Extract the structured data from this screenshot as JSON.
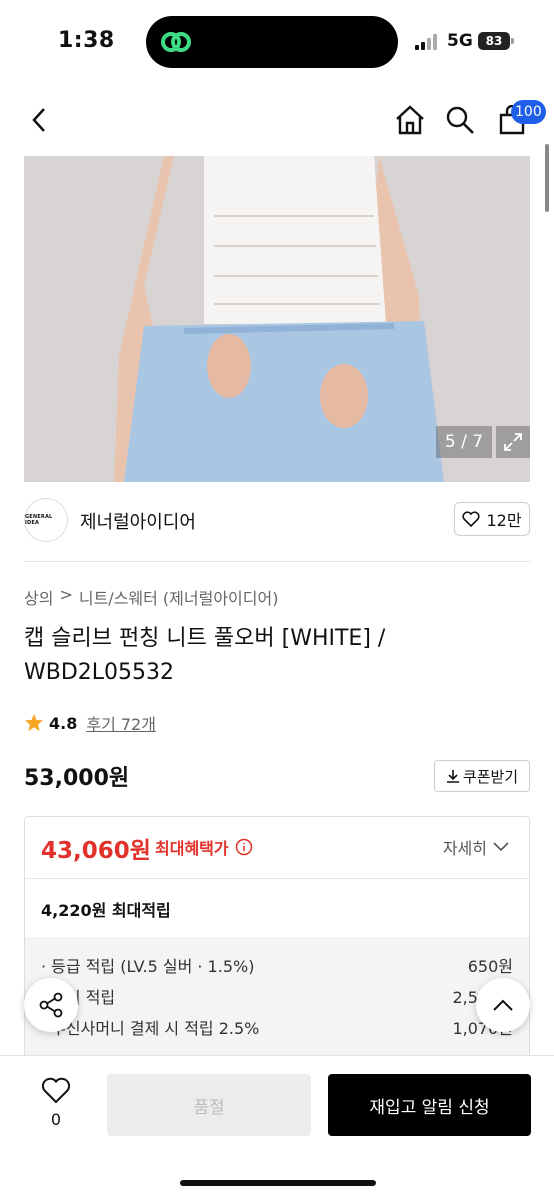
{
  "status": {
    "time": "1:38",
    "network": "5G",
    "battery": "83"
  },
  "nav": {
    "cart_count": "100"
  },
  "hero": {
    "counter": "5 / 7"
  },
  "brand": {
    "logo_text": "GENERAL IDEA",
    "name": "제너럴아이디어",
    "likes": "12만"
  },
  "breadcrumb": {
    "level1": "상의",
    "separator": ">",
    "level2": "니트/스웨터 (제너럴아이디어)"
  },
  "product": {
    "title": "캡 슬리브 펀칭 니트 풀오버 [WHITE] / WBD2L05532",
    "rating": "4.8",
    "reviews": "후기 72개",
    "price": "53,000원",
    "coupon_label": "쿠폰받기"
  },
  "benefit": {
    "sale_price": "43,060원",
    "sale_label": "최대혜택가",
    "detail_label": "자세히",
    "points_max": "4,220원 최대적립",
    "rows": [
      {
        "label": "· 등급 적립 (LV.5 실버 · 1.5%)",
        "value": "650원"
      },
      {
        "label": "· 후기 적립",
        "value": "2,500원"
      },
      {
        "label": "· 무신사머니 결제 시 적립 2.5%",
        "value": "1,070원"
      }
    ]
  },
  "bottom": {
    "like_count": "0",
    "soldout_label": "품절",
    "restock_label": "재입고 알림 신청"
  },
  "colors": {
    "sale": "#e0322b",
    "badge": "#1f5ee6",
    "star": "#f5a623"
  }
}
